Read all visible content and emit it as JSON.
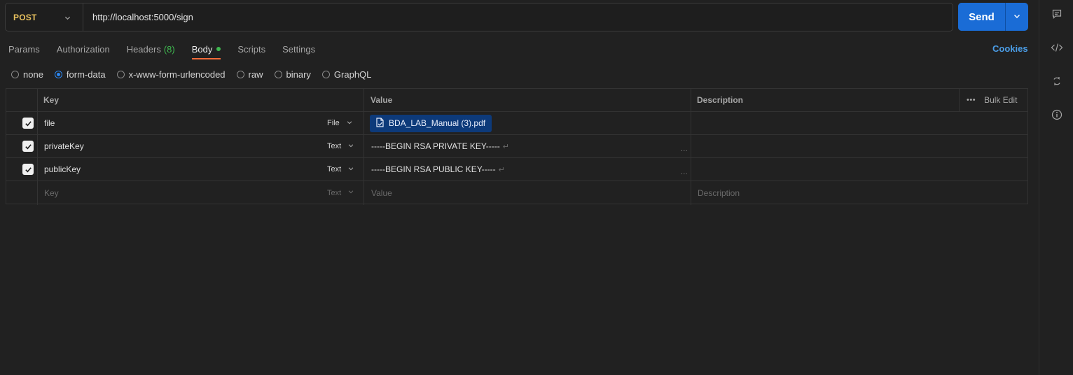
{
  "request": {
    "method": "POST",
    "url": "http://localhost:5000/sign",
    "send_label": "Send"
  },
  "tabs": [
    {
      "label": "Params"
    },
    {
      "label": "Authorization"
    },
    {
      "label": "Headers",
      "count": "(8)"
    },
    {
      "label": "Body"
    },
    {
      "label": "Scripts"
    },
    {
      "label": "Settings"
    }
  ],
  "cookies_label": "Cookies",
  "body_types": [
    {
      "label": "none"
    },
    {
      "label": "form-data"
    },
    {
      "label": "x-www-form-urlencoded"
    },
    {
      "label": "raw"
    },
    {
      "label": "binary"
    },
    {
      "label": "GraphQL"
    }
  ],
  "body_type_selected": "form-data",
  "table": {
    "headers": {
      "key": "Key",
      "value": "Value",
      "description": "Description",
      "bulk_edit": "Bulk Edit"
    },
    "rows": [
      {
        "key": "file",
        "type": "File",
        "value": "BDA_LAB_Manual (3).pdf"
      },
      {
        "key": "privateKey",
        "type": "Text",
        "value": "-----BEGIN RSA PRIVATE KEY-----"
      },
      {
        "key": "publicKey",
        "type": "Text",
        "value": "-----BEGIN RSA PUBLIC KEY-----"
      }
    ],
    "placeholder": {
      "key": "Key",
      "type": "Text",
      "value": "Value",
      "description": "Description"
    }
  },
  "return_glyph": "↵",
  "ellipsis": "...",
  "more_glyph": "•••",
  "colors": {
    "accent": "#1a6cd6",
    "method": "#e8c15e",
    "tab_underline": "#f26b3a",
    "dot": "#3fb950",
    "link": "#4b9ee8"
  },
  "icons": [
    "chevron-down-icon",
    "comment-icon",
    "code-icon",
    "refresh-icon",
    "info-icon",
    "file-icon",
    "check-icon"
  ]
}
